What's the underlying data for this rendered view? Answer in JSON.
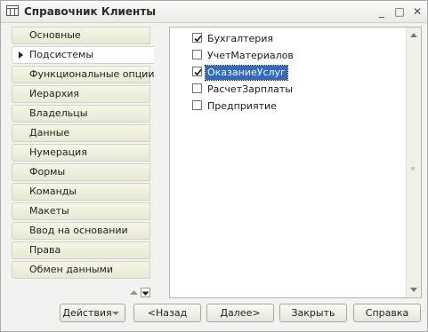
{
  "window": {
    "title": "Справочник Клиенты",
    "minimize_symbol": "_",
    "maximize_symbol": "□",
    "close_symbol": "✕"
  },
  "tabs": [
    {
      "label": "Основные",
      "active": false
    },
    {
      "label": "Подсистемы",
      "active": true
    },
    {
      "label": "Функциональные опции",
      "active": false
    },
    {
      "label": "Иерархия",
      "active": false
    },
    {
      "label": "Владельцы",
      "active": false
    },
    {
      "label": "Данные",
      "active": false
    },
    {
      "label": "Нумерация",
      "active": false
    },
    {
      "label": "Формы",
      "active": false
    },
    {
      "label": "Команды",
      "active": false
    },
    {
      "label": "Макеты",
      "active": false
    },
    {
      "label": "Ввод на основании",
      "active": false
    },
    {
      "label": "Права",
      "active": false
    },
    {
      "label": "Обмен данными",
      "active": false
    }
  ],
  "subsystems": [
    {
      "label": "Бухгалтерия",
      "checked": true,
      "selected": false
    },
    {
      "label": "УчетМатериалов",
      "checked": false,
      "selected": false
    },
    {
      "label": "ОказаниеУслуг",
      "checked": true,
      "selected": true
    },
    {
      "label": "РасчетЗарплаты",
      "checked": false,
      "selected": false
    },
    {
      "label": "Предприятие",
      "checked": false,
      "selected": false
    }
  ],
  "buttons": {
    "actions": "Действия",
    "back": "<Назад",
    "next": "Далее>",
    "close": "Закрыть",
    "help": "Справка"
  },
  "colors": {
    "selection": "#316ac5",
    "tab_bg": "#eeeedd",
    "window_bg": "#f2f2f0"
  }
}
